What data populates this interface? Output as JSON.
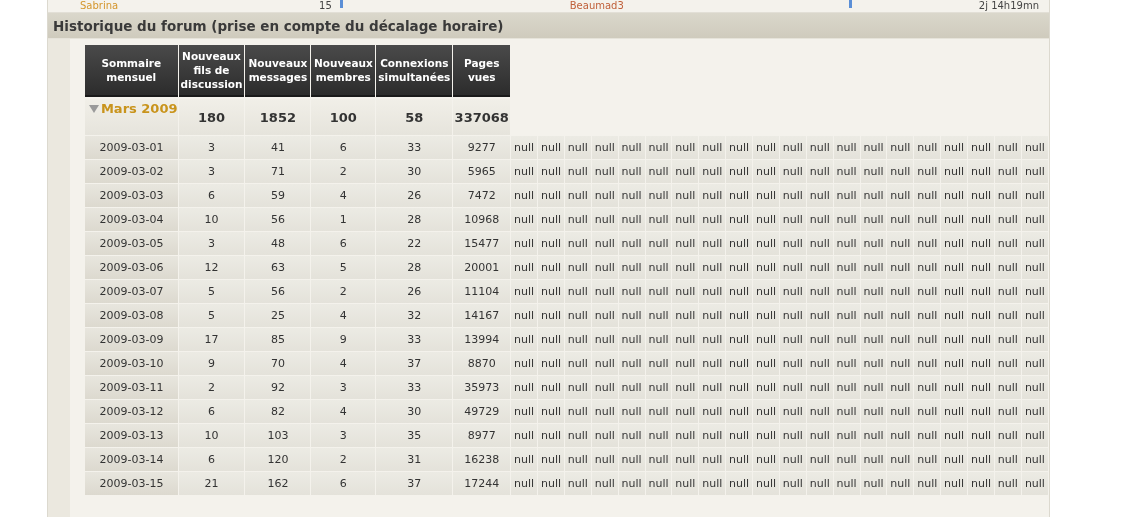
{
  "previous_row": {
    "member": "Sabrina",
    "count": "15",
    "last_member": "Beaumad3",
    "duration": "2j 14h19mn"
  },
  "section": {
    "title": "Historique du forum (prise en compte du décalage horaire)"
  },
  "table": {
    "columns": [
      "Sommaire mensuel",
      "Nouveaux fils de discussion",
      "Nouveaux messages",
      "Nouveaux membres",
      "Connexions simultanées",
      "Pages vues"
    ],
    "month": {
      "label": "Mars 2009",
      "expanded": true,
      "values": [
        "180",
        "1852",
        "100",
        "58",
        "337068"
      ]
    },
    "rows": [
      {
        "date": "2009-03-01",
        "values": [
          "3",
          "41",
          "6",
          "33",
          "9277"
        ],
        "extra": [
          "null",
          "null",
          "null",
          "null",
          "null",
          "null",
          "null",
          "null",
          "null",
          "null",
          "null",
          "null",
          "null",
          "null",
          "null",
          "null",
          "null",
          "null",
          "null",
          "null"
        ]
      },
      {
        "date": "2009-03-02",
        "values": [
          "3",
          "71",
          "2",
          "30",
          "5965"
        ],
        "extra": [
          "null",
          "null",
          "null",
          "null",
          "null",
          "null",
          "null",
          "null",
          "null",
          "null",
          "null",
          "null",
          "null",
          "null",
          "null",
          "null",
          "null",
          "null",
          "null",
          "null"
        ]
      },
      {
        "date": "2009-03-03",
        "values": [
          "6",
          "59",
          "4",
          "26",
          "7472"
        ],
        "extra": [
          "null",
          "null",
          "null",
          "null",
          "null",
          "null",
          "null",
          "null",
          "null",
          "null",
          "null",
          "null",
          "null",
          "null",
          "null",
          "null",
          "null",
          "null",
          "null",
          "null"
        ]
      },
      {
        "date": "2009-03-04",
        "values": [
          "10",
          "56",
          "1",
          "28",
          "10968"
        ],
        "extra": [
          "null",
          "null",
          "null",
          "null",
          "null",
          "null",
          "null",
          "null",
          "null",
          "null",
          "null",
          "null",
          "null",
          "null",
          "null",
          "null",
          "null",
          "null",
          "null",
          "null"
        ]
      },
      {
        "date": "2009-03-05",
        "values": [
          "3",
          "48",
          "6",
          "22",
          "15477"
        ],
        "extra": [
          "null",
          "null",
          "null",
          "null",
          "null",
          "null",
          "null",
          "null",
          "null",
          "null",
          "null",
          "null",
          "null",
          "null",
          "null",
          "null",
          "null",
          "null",
          "null",
          "null"
        ]
      },
      {
        "date": "2009-03-06",
        "values": [
          "12",
          "63",
          "5",
          "28",
          "20001"
        ],
        "extra": [
          "null",
          "null",
          "null",
          "null",
          "null",
          "null",
          "null",
          "null",
          "null",
          "null",
          "null",
          "null",
          "null",
          "null",
          "null",
          "null",
          "null",
          "null",
          "null",
          "null"
        ]
      },
      {
        "date": "2009-03-07",
        "values": [
          "5",
          "56",
          "2",
          "26",
          "11104"
        ],
        "extra": [
          "null",
          "null",
          "null",
          "null",
          "null",
          "null",
          "null",
          "null",
          "null",
          "null",
          "null",
          "null",
          "null",
          "null",
          "null",
          "null",
          "null",
          "null",
          "null",
          "null"
        ]
      },
      {
        "date": "2009-03-08",
        "values": [
          "5",
          "25",
          "4",
          "32",
          "14167"
        ],
        "extra": [
          "null",
          "null",
          "null",
          "null",
          "null",
          "null",
          "null",
          "null",
          "null",
          "null",
          "null",
          "null",
          "null",
          "null",
          "null",
          "null",
          "null",
          "null",
          "null",
          "null"
        ]
      },
      {
        "date": "2009-03-09",
        "values": [
          "17",
          "85",
          "9",
          "33",
          "13994"
        ],
        "extra": [
          "null",
          "null",
          "null",
          "null",
          "null",
          "null",
          "null",
          "null",
          "null",
          "null",
          "null",
          "null",
          "null",
          "null",
          "null",
          "null",
          "null",
          "null",
          "null",
          "null"
        ]
      },
      {
        "date": "2009-03-10",
        "values": [
          "9",
          "70",
          "4",
          "37",
          "8870"
        ],
        "extra": [
          "null",
          "null",
          "null",
          "null",
          "null",
          "null",
          "null",
          "null",
          "null",
          "null",
          "null",
          "null",
          "null",
          "null",
          "null",
          "null",
          "null",
          "null",
          "null",
          "null"
        ]
      },
      {
        "date": "2009-03-11",
        "values": [
          "2",
          "92",
          "3",
          "33",
          "35973"
        ],
        "extra": [
          "null",
          "null",
          "null",
          "null",
          "null",
          "null",
          "null",
          "null",
          "null",
          "null",
          "null",
          "null",
          "null",
          "null",
          "null",
          "null",
          "null",
          "null",
          "null",
          "null"
        ]
      },
      {
        "date": "2009-03-12",
        "values": [
          "6",
          "82",
          "4",
          "30",
          "49729"
        ],
        "extra": [
          "null",
          "null",
          "null",
          "null",
          "null",
          "null",
          "null",
          "null",
          "null",
          "null",
          "null",
          "null",
          "null",
          "null",
          "null",
          "null",
          "null",
          "null",
          "null",
          "null"
        ]
      },
      {
        "date": "2009-03-13",
        "values": [
          "10",
          "103",
          "3",
          "35",
          "8977"
        ],
        "extra": [
          "null",
          "null",
          "null",
          "null",
          "null",
          "null",
          "null",
          "null",
          "null",
          "null",
          "null",
          "null",
          "null",
          "null",
          "null",
          "null",
          "null",
          "null",
          "null",
          "null"
        ]
      },
      {
        "date": "2009-03-14",
        "values": [
          "6",
          "120",
          "2",
          "31",
          "16238"
        ],
        "extra": [
          "null",
          "null",
          "null",
          "null",
          "null",
          "null",
          "null",
          "null",
          "null",
          "null",
          "null",
          "null",
          "null",
          "null",
          "null",
          "null",
          "null",
          "null",
          "null",
          "null"
        ]
      },
      {
        "date": "2009-03-15",
        "values": [
          "21",
          "162",
          "6",
          "37",
          "17244"
        ],
        "extra": [
          "null",
          "null",
          "null",
          "null",
          "null",
          "null",
          "null",
          "null",
          "null",
          "null",
          "null",
          "null",
          "null",
          "null",
          "null",
          "null",
          "null",
          "null",
          "null",
          "null"
        ]
      }
    ]
  }
}
